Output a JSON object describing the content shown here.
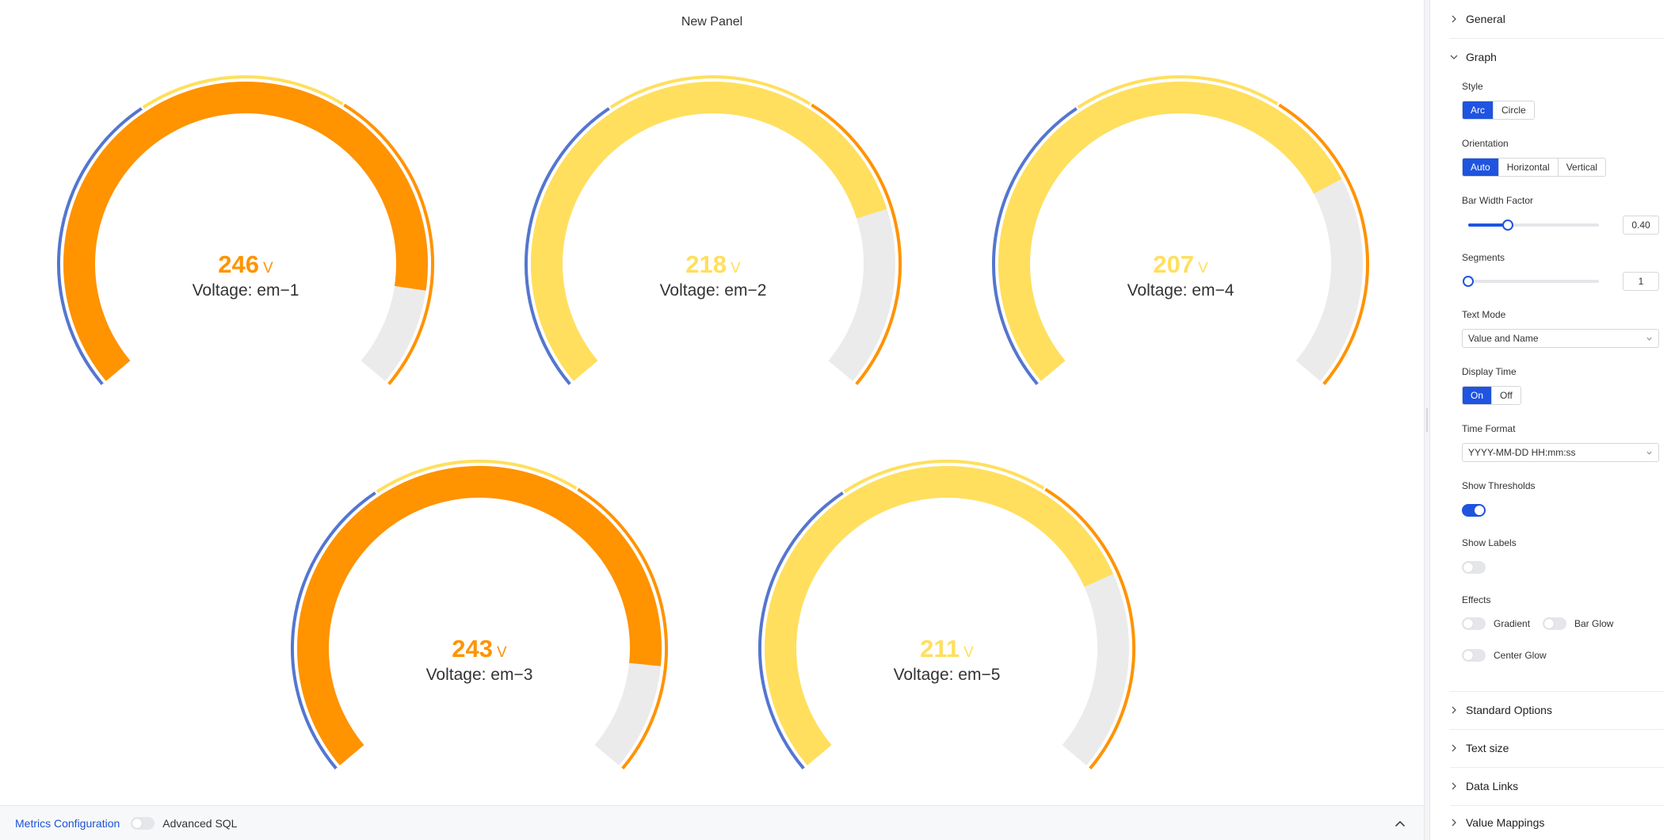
{
  "panel": {
    "title": "New Panel"
  },
  "colors": {
    "orange": "#ff9300",
    "yellow": "#ffdf5d",
    "blue": "#5476cf",
    "track": "#ebebeb",
    "accent": "#1f54e0"
  },
  "gauges": [
    {
      "value": 246,
      "unit": "V",
      "name": "Voltage: em−1",
      "fill_color": "orange"
    },
    {
      "value": 218,
      "unit": "V",
      "name": "Voltage: em−2",
      "fill_color": "yellow"
    },
    {
      "value": 207,
      "unit": "V",
      "name": "Voltage: em−4",
      "fill_color": "yellow"
    },
    {
      "value": 243,
      "unit": "V",
      "name": "Voltage: em−3",
      "fill_color": "orange"
    },
    {
      "value": 211,
      "unit": "V",
      "name": "Voltage: em−5",
      "fill_color": "yellow"
    }
  ],
  "bottom_bar": {
    "metrics_link": "Metrics Configuration",
    "advanced_sql_label": "Advanced SQL",
    "advanced_sql_on": false
  },
  "sidebar": {
    "general": "General",
    "graph": "Graph",
    "style": {
      "label": "Style",
      "options": [
        "Arc",
        "Circle"
      ],
      "selected": "Arc"
    },
    "orientation": {
      "label": "Orientation",
      "options": [
        "Auto",
        "Horizontal",
        "Vertical"
      ],
      "selected": "Auto"
    },
    "bar_width_factor": {
      "label": "Bar Width Factor",
      "value": "0.40",
      "fraction": 0.3
    },
    "segments": {
      "label": "Segments",
      "value": "1",
      "fraction": 0
    },
    "text_mode": {
      "label": "Text Mode",
      "value": "Value and Name"
    },
    "display_time": {
      "label": "Display Time",
      "options": [
        "On",
        "Off"
      ],
      "selected": "On"
    },
    "time_format": {
      "label": "Time Format",
      "value": "YYYY-MM-DD HH:mm:ss"
    },
    "show_thresholds": {
      "label": "Show Thresholds",
      "on": true
    },
    "show_labels": {
      "label": "Show Labels",
      "on": false
    },
    "effects": {
      "label": "Effects",
      "gradient": "Gradient",
      "bar_glow": "Bar Glow",
      "center_glow": "Center Glow"
    },
    "standard_options": "Standard Options",
    "text_size": "Text size",
    "data_links": "Data Links",
    "value_mappings": "Value Mappings"
  }
}
